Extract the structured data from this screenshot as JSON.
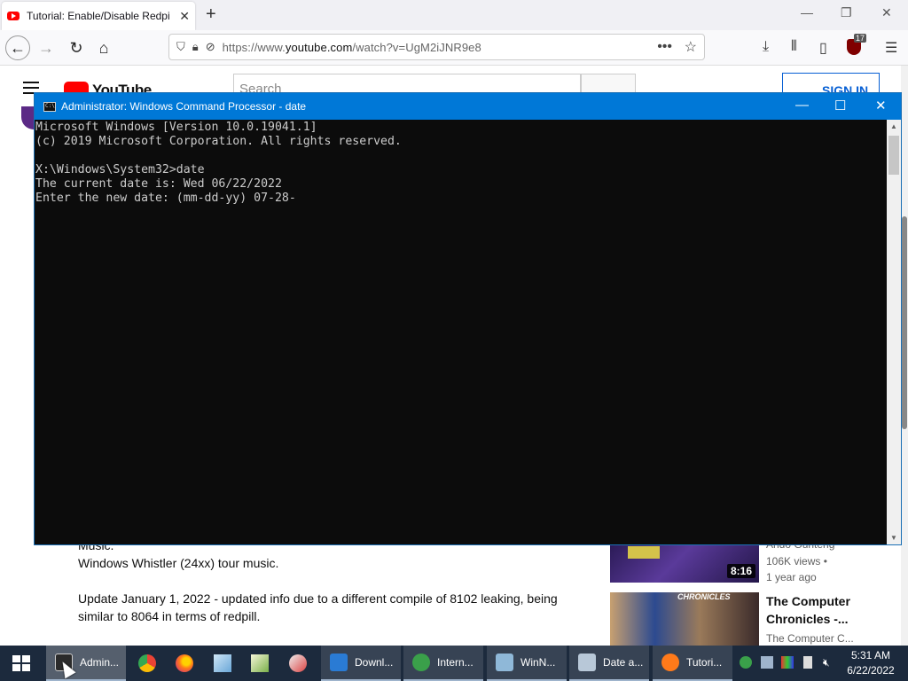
{
  "browser": {
    "tab_title": "Tutorial: Enable/Disable Redpill",
    "tab_close": "✕",
    "new_tab": "+",
    "url_prefix": "https://www.",
    "url_domain": "youtube.com",
    "url_path": "/watch?v=UgM2iJNR9e8",
    "url_more": "•••",
    "extension_badge": "17",
    "window_controls": [
      "—",
      "❐",
      "✕"
    ]
  },
  "youtube": {
    "logo_text": "YouTube",
    "search_placeholder": "Search",
    "signin_label": "SIGN IN",
    "description": {
      "line1": "Music.",
      "line2": "Windows Whistler (24xx) tour music.",
      "para2": "Update January 1, 2022 - updated info due to a different compile of 8102 leaking, being similar to 8064 in terms of redpill."
    },
    "recommendations": [
      {
        "duration": "8:16",
        "channel": "Ando Gunteng",
        "views": "106K views •",
        "age": "1 year ago"
      },
      {
        "title_line1": "The Computer",
        "title_line2": "Chronicles -...",
        "channel": "The Computer C...",
        "thumb_brand": "CHRONICLES"
      }
    ]
  },
  "cmd": {
    "title": "Administrator: Windows Command Processor - date",
    "window_controls": [
      "—",
      "☐",
      "✕"
    ],
    "lines": [
      "Microsoft Windows [Version 10.0.19041.1]",
      "(c) 2019 Microsoft Corporation. All rights reserved.",
      "",
      "X:\\Windows\\System32>date",
      "The current date is: Wed 06/22/2022",
      "Enter the new date: (mm-dd-yy) 07-28-"
    ]
  },
  "taskbar": {
    "items": [
      {
        "label": "Admin...",
        "color": "#2b2b2b"
      },
      {
        "label": "Downl...",
        "color": "#2a7bd4"
      },
      {
        "label": "Intern...",
        "color": "#3aa04a"
      },
      {
        "label": "WinN...",
        "color": "#8fb8d8"
      },
      {
        "label": "Date a...",
        "color": "#b8c8d8"
      },
      {
        "label": "Tutori...",
        "color": "#ff7a1a"
      }
    ],
    "time": "5:31 AM",
    "date": "6/22/2022"
  }
}
